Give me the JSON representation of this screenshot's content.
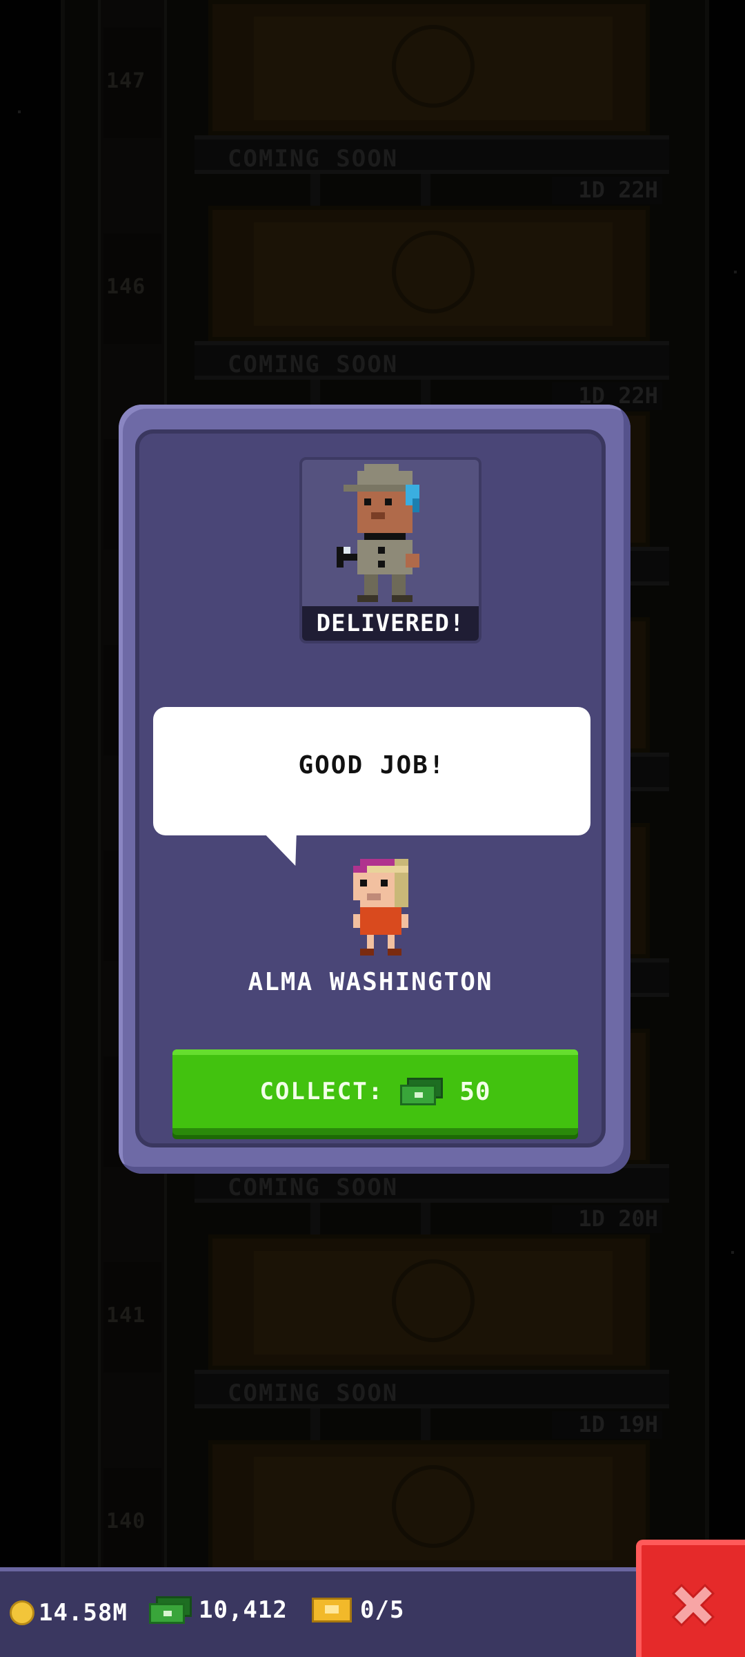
{
  "background": {
    "floors": [
      {
        "number": "147",
        "status": "COMING SOON",
        "timer": "1D 22H"
      },
      {
        "number": "146",
        "status": "COMING SOON",
        "timer": "1D 22H"
      },
      {
        "number": "141",
        "status": "COMING SOON",
        "timer": "1D 20H"
      },
      {
        "number": "140",
        "status": "COMING SOON",
        "timer": "1D 19H"
      }
    ]
  },
  "dialog": {
    "badge": "DELIVERED!",
    "speech": "GOOD JOB!",
    "resident_name": "ALMA WASHINGTON",
    "collect_label": "COLLECT:",
    "collect_value": "50"
  },
  "hud": {
    "coins": "14.58M",
    "bux": "10,412",
    "tickets": "0/5"
  },
  "colors": {
    "dialog_bg": "#4a4677",
    "collect_button": "#42c20f",
    "close_button": "#e52a2a",
    "coin": "#f2c53a"
  },
  "icons": {
    "close": "x-icon",
    "coin": "coin-icon",
    "bux": "tower-bux-icon",
    "tickets": "vip-ticket-icon"
  }
}
